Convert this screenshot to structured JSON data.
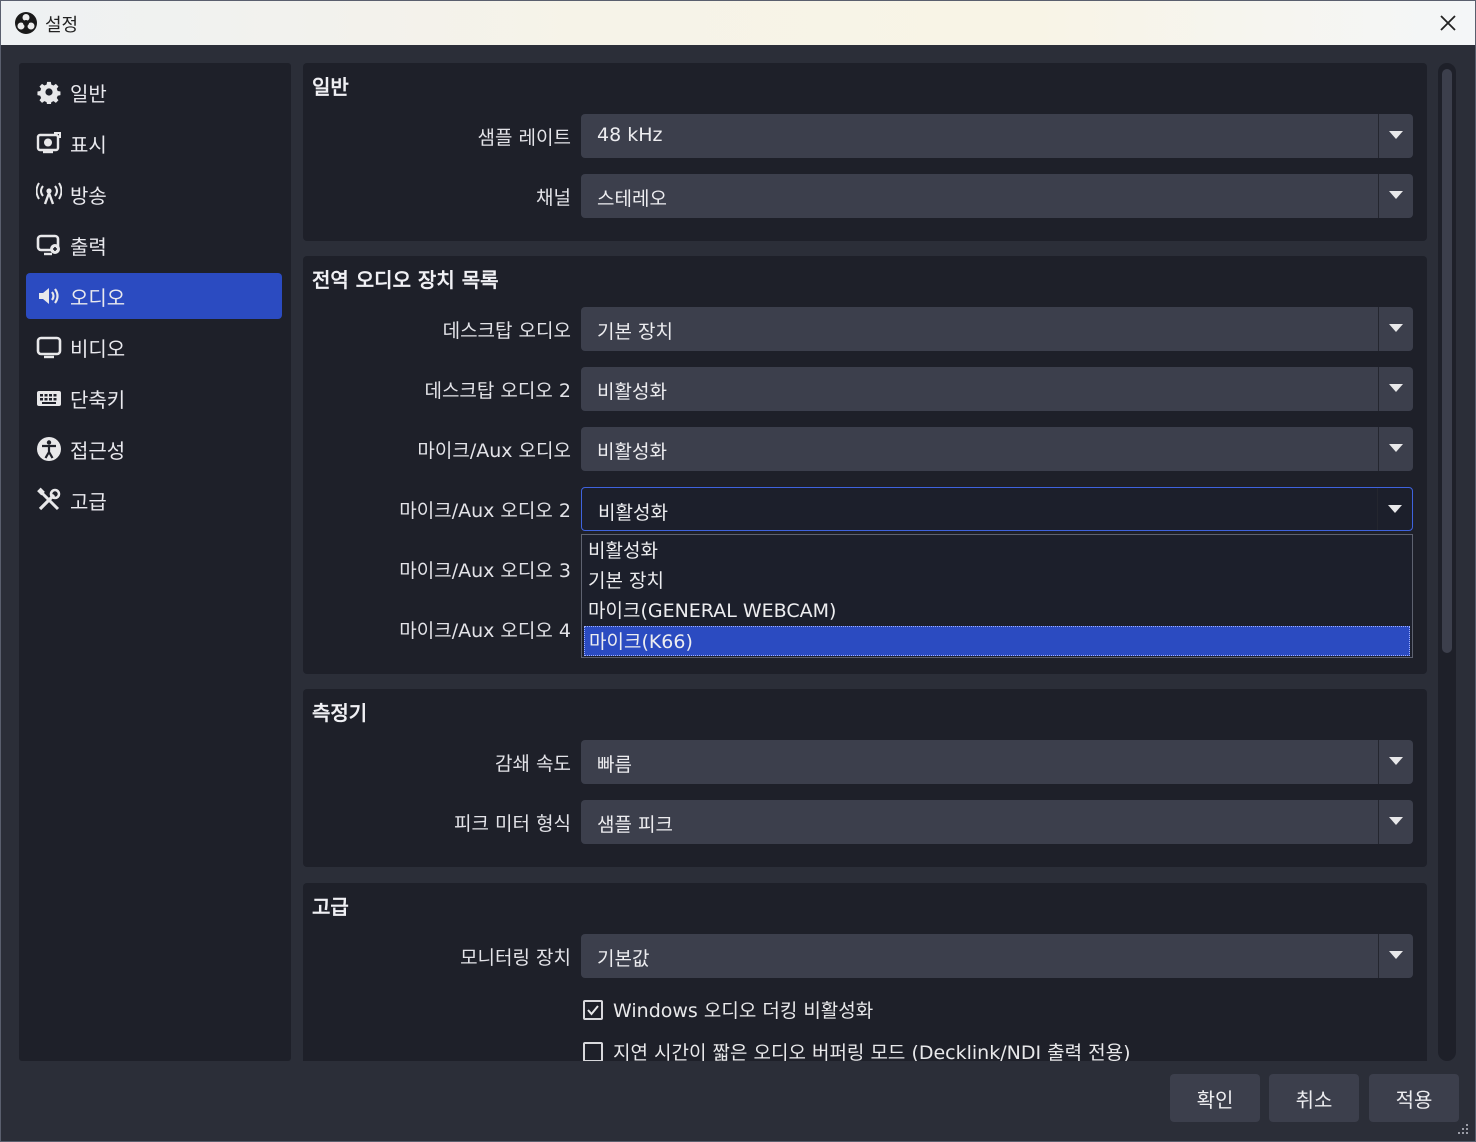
{
  "window": {
    "title": "설정"
  },
  "sidebar": {
    "items": [
      {
        "label": "일반",
        "icon": "gear-icon"
      },
      {
        "label": "표시",
        "icon": "display-icon"
      },
      {
        "label": "방송",
        "icon": "antenna-icon"
      },
      {
        "label": "출력",
        "icon": "output-icon"
      },
      {
        "label": "오디오",
        "icon": "speaker-icon",
        "active": true
      },
      {
        "label": "비디오",
        "icon": "monitor-icon"
      },
      {
        "label": "단축키",
        "icon": "keyboard-icon"
      },
      {
        "label": "접근성",
        "icon": "accessibility-icon"
      },
      {
        "label": "고급",
        "icon": "tools-icon"
      }
    ]
  },
  "general": {
    "title": "일반",
    "sample_rate": {
      "label": "샘플 레이트",
      "value": "48 kHz"
    },
    "channels": {
      "label": "채널",
      "value": "스테레오"
    }
  },
  "global_devices": {
    "title": "전역 오디오 장치 목록",
    "desktop_audio": {
      "label": "데스크탑 오디오",
      "value": "기본 장치"
    },
    "desktop_audio_2": {
      "label": "데스크탑 오디오 2",
      "value": "비활성화"
    },
    "mic_aux": {
      "label": "마이크/Aux 오디오",
      "value": "비활성화"
    },
    "mic_aux_2": {
      "label": "마이크/Aux 오디오 2",
      "value": "비활성화"
    },
    "mic_aux_3": {
      "label": "마이크/Aux 오디오 3"
    },
    "mic_aux_4": {
      "label": "마이크/Aux 오디오 4"
    }
  },
  "dropdown": {
    "options": [
      "비활성화",
      "기본 장치",
      "마이크(GENERAL WEBCAM)",
      "마이크(K66)"
    ],
    "selected_index": 3
  },
  "meters": {
    "title": "측정기",
    "decay_rate": {
      "label": "감쇄 속도",
      "value": "빠름"
    },
    "peak_meter": {
      "label": "피크 미터 형식",
      "value": "샘플 피크"
    }
  },
  "advanced": {
    "title": "고급",
    "monitoring_device": {
      "label": "모니터링 장치",
      "value": "기본값"
    },
    "ducking": {
      "label": "Windows 오디오 더킹 비활성화",
      "checked": true
    },
    "low_latency": {
      "label": "지연 시간이 짧은 오디오 버퍼링 모드 (Decklink/NDI 출력 전용)",
      "checked": false
    }
  },
  "footer": {
    "ok": "확인",
    "cancel": "취소",
    "apply": "적용"
  },
  "colors": {
    "accent": "#2b4bc1",
    "panel": "#1e2029",
    "control": "#3c3f4c",
    "background": "#2b2e38"
  }
}
